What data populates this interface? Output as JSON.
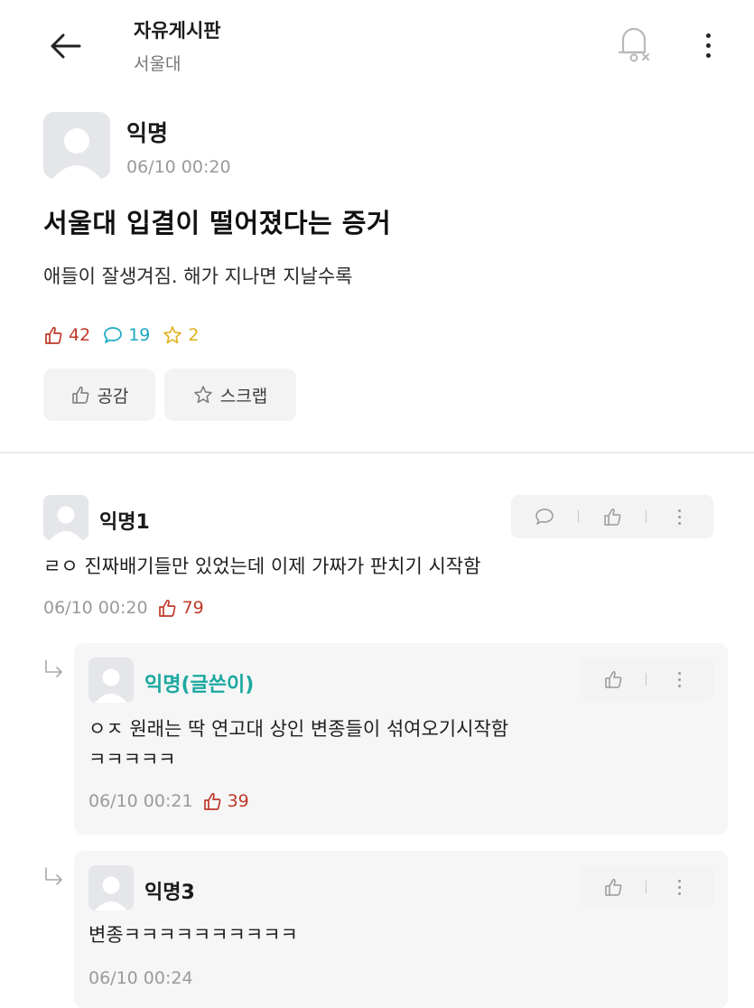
{
  "header": {
    "title": "자유게시판",
    "subtitle": "서울대"
  },
  "post": {
    "author": "익명",
    "date": "06/10 00:20",
    "title": "서울대 입결이 떨어졌다는 증거",
    "body": "애들이 잘생겨짐. 해가 지나면 지날수록",
    "likes": "42",
    "comments": "19",
    "scraps": "2",
    "like_button": "공감",
    "scrap_button": "스크랩"
  },
  "comments": [
    {
      "author": "익명1",
      "body": "ㄹㅇ 진짜배기들만 있었는데 이제 가짜가 판치기 시작함",
      "date": "06/10 00:20",
      "likes": "79"
    }
  ],
  "replies": [
    {
      "author": "익명(글쓴이)",
      "body_line1": "ㅇㅈ 원래는 딱 연고대 상인 변종들이 섞여오기시작함",
      "body_line2": "ㅋㅋㅋㅋㅋ",
      "date": "06/10 00:21",
      "likes": "39"
    },
    {
      "author": "익명3",
      "body": "변종ㅋㅋㅋㅋㅋㅋㅋㅋㅋㅋ",
      "date": "06/10 00:24"
    }
  ],
  "colors": {
    "like": "#c0392b",
    "comment": "#1aa8c1",
    "scrap": "#e0b11a",
    "op_author": "#1aa8a0"
  },
  "icons": {
    "back": "arrow-left-icon",
    "bell": "bell-off-icon",
    "more": "more-vertical-icon",
    "like": "thumbs-up-icon",
    "comment": "chat-bubble-icon",
    "scrap": "star-icon",
    "reply": "reply-arrow-icon"
  }
}
